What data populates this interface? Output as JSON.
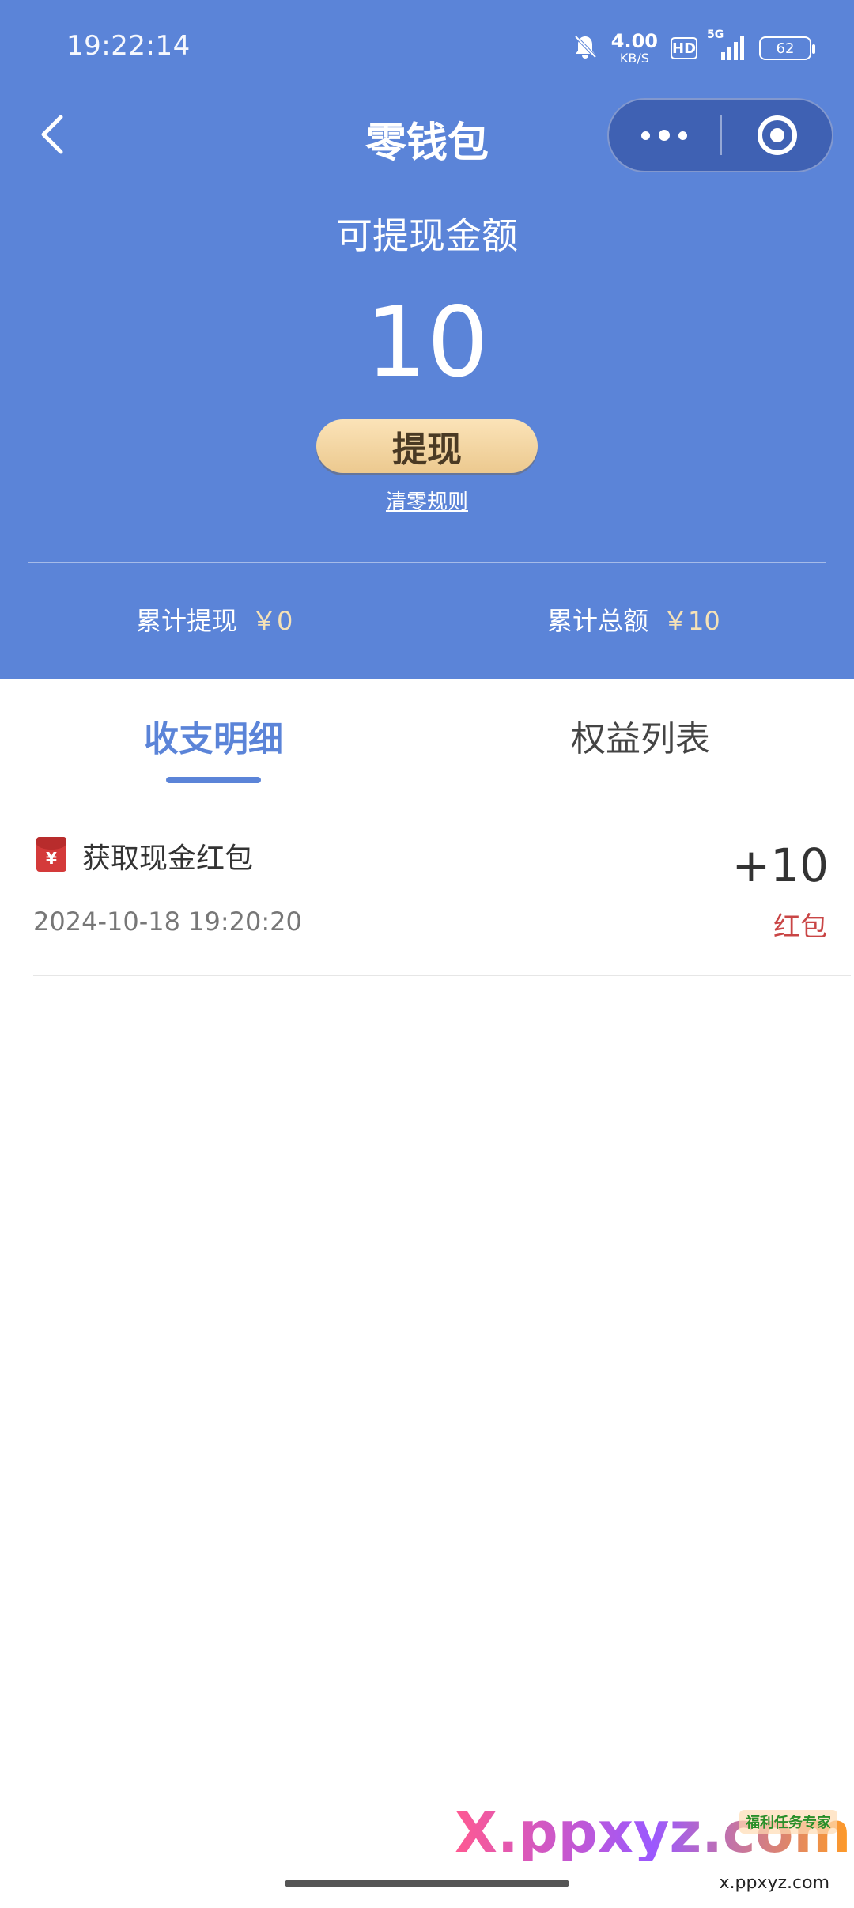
{
  "status_bar": {
    "time": "19:22:14",
    "net_speed_value": "4.00",
    "net_speed_unit": "KB/S",
    "hd": "HD",
    "network": "5G",
    "battery": "62"
  },
  "nav": {
    "title": "零钱包"
  },
  "balance": {
    "label": "可提现金额",
    "amount": "10",
    "withdraw_label": "提现",
    "clear_rule_label": "清零规则"
  },
  "stats": {
    "withdrawn_label": "累计提现",
    "withdrawn_value": "￥0",
    "total_label": "累计总额",
    "total_value": "￥10"
  },
  "tabs": [
    {
      "label": "收支明细",
      "active": true
    },
    {
      "label": "权益列表",
      "active": false
    }
  ],
  "records": [
    {
      "icon": "red-envelope-icon",
      "title": "获取现金红包",
      "amount": "+10",
      "time": "2024-10-18 19:20:20",
      "type": "红包"
    }
  ],
  "watermark": {
    "site": "X.ppxyz.com",
    "badge": "福利任务专家",
    "sub": "x.ppxyz.com"
  },
  "colors": {
    "header_bg": "#5b84d8",
    "accent": "#5b84d8",
    "button_gold": "#ecc98f",
    "red": "#c94545"
  }
}
